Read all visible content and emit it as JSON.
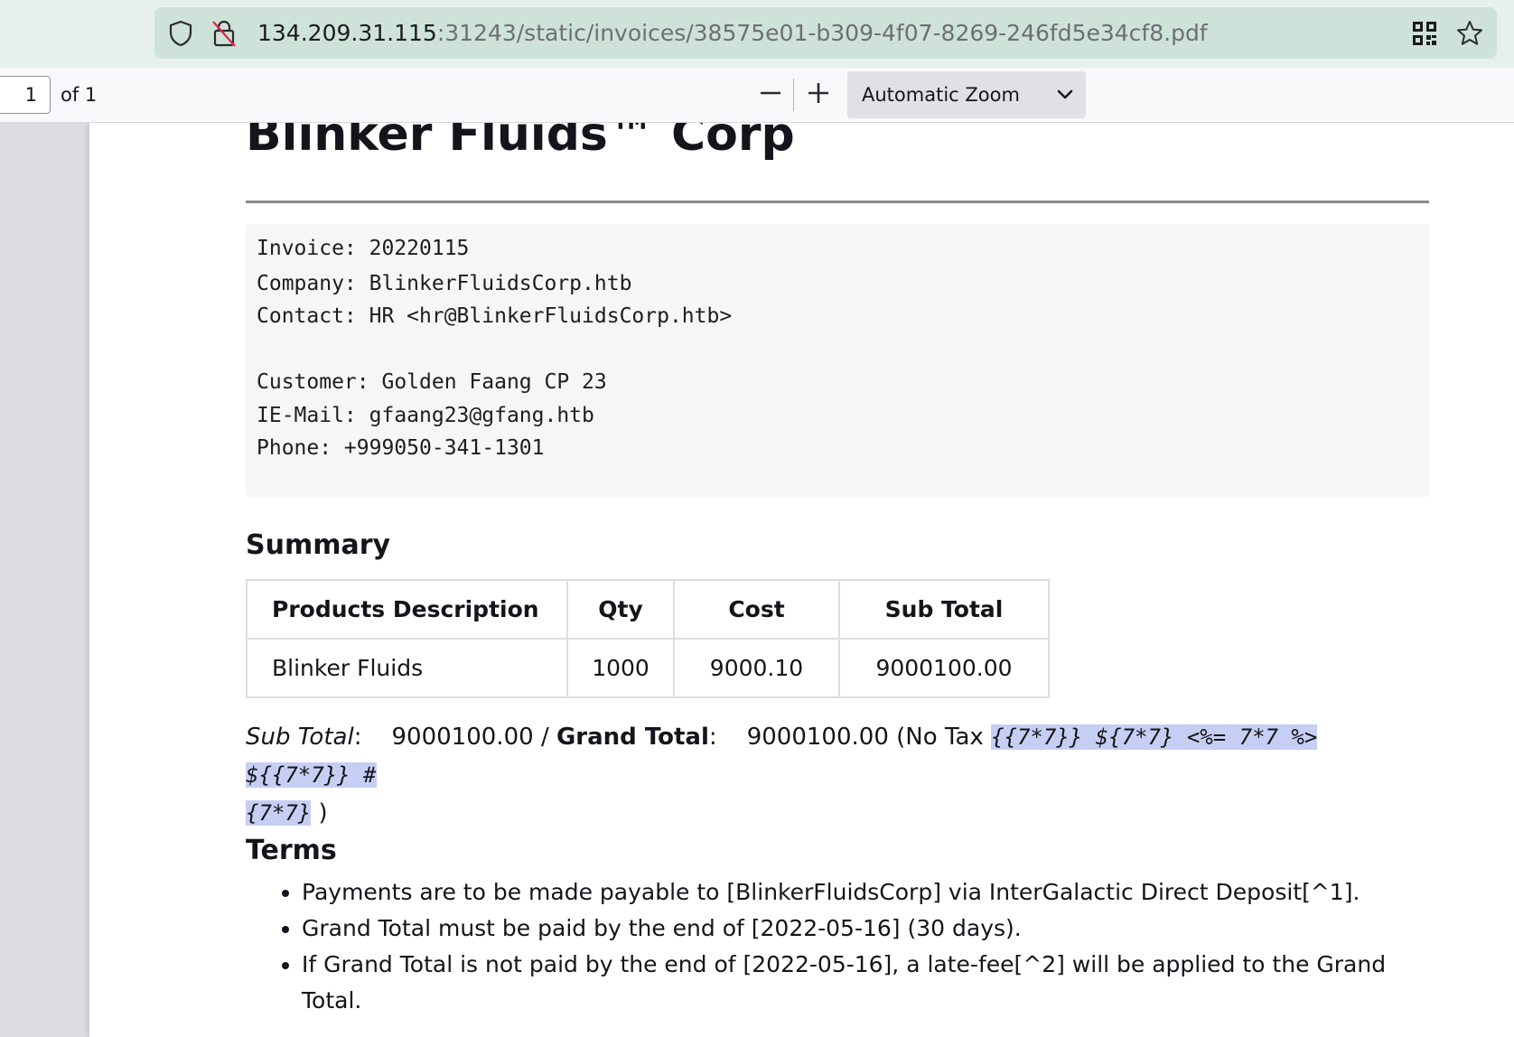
{
  "browser": {
    "url_host": "134.209.31.115",
    "url_path": ":31243/static/invoices/38575e01-b309-4f07-8269-246fd5e34cf8.pdf"
  },
  "pdf_toolbar": {
    "page_number": "1",
    "page_total_label": "of 1",
    "zoom_label": "Automatic Zoom"
  },
  "invoice": {
    "company_title": "Blinker Fluids™ Corp",
    "info_lines": [
      "Invoice: 20220115",
      "Company: BlinkerFluidsCorp.htb",
      "Contact: HR <hr@BlinkerFluidsCorp.htb>",
      "Customer: Golden Faang CP 23",
      "IE-Mail: gfaang23@gfang.htb",
      "Phone: +999050-341-1301"
    ],
    "summary_heading": "Summary",
    "table": {
      "headers": [
        "Products Description",
        "Qty",
        "Cost",
        "Sub Total"
      ],
      "rows": [
        [
          "Blinker Fluids",
          "1000",
          "9000.10",
          "9000100.00"
        ]
      ]
    },
    "totals": {
      "subtotal_label": "Sub Total",
      "subtotal_value": "9000100.00",
      "separator": "/",
      "grand_total_label": "Grand Total",
      "grand_total_value": "9000100.00",
      "tax_prefix": "(No Tax",
      "tax_payload_line1": "{{7*7}} ${7*7} <%= 7*7 %> ${{7*7}} #",
      "tax_payload_line2": "{7*7}",
      "tax_suffix": ")"
    },
    "terms_heading": "Terms",
    "terms": [
      "Payments are to be made payable to [BlinkerFluidsCorp] via InterGalactic Direct Deposit[^1].",
      "Grand Total must be paid by the end of [2022-05-16] (30 days).",
      "If Grand Total is not paid by the end of [2022-05-16], a late-fee[^2] will be applied to the Grand Total."
    ]
  },
  "icons": {
    "shield": "shield-icon",
    "lock": "lock-insecure-icon",
    "qr": "qr-code-icon",
    "star": "bookmark-star-icon",
    "zoom_out": "minus-icon",
    "zoom_in": "plus-icon",
    "chevron": "chevron-down-icon"
  }
}
